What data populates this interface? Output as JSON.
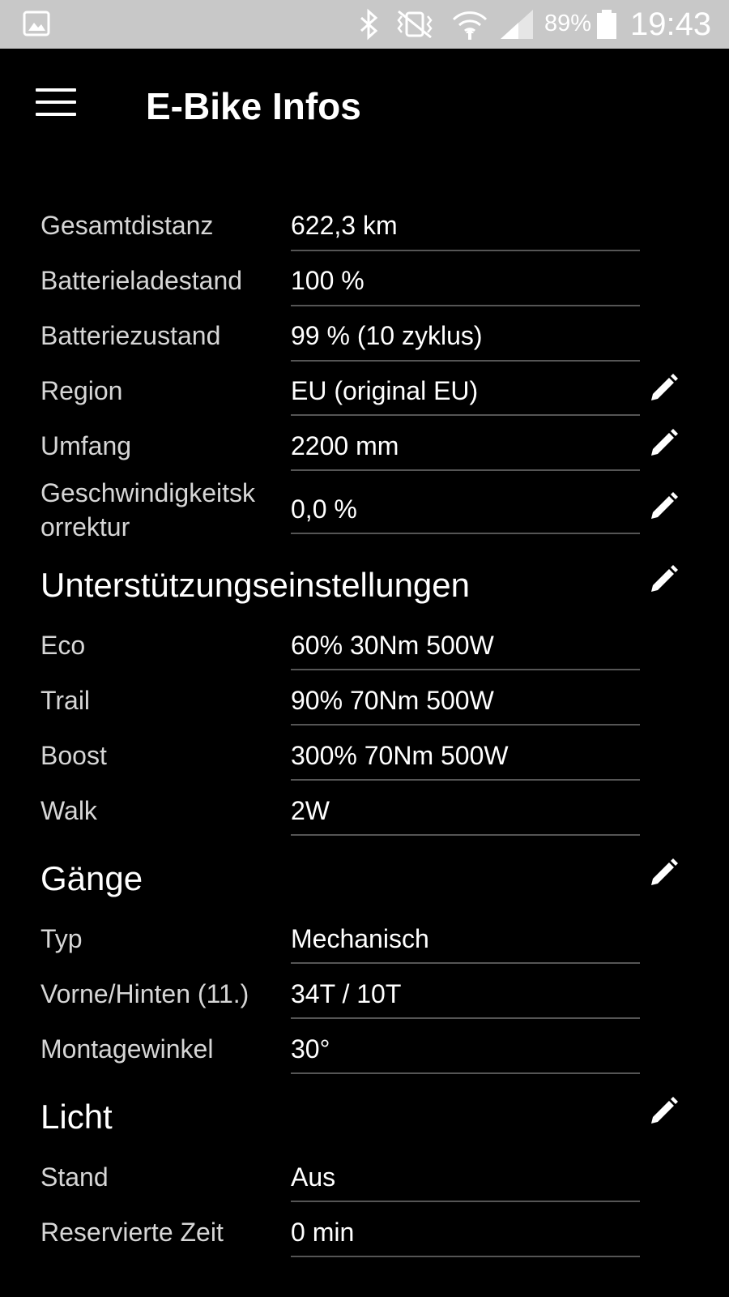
{
  "status_bar": {
    "battery_percent": "89%",
    "time": "19:43",
    "icons": [
      "gallery-icon",
      "bluetooth-icon",
      "vibrate-icon",
      "wifi-icon",
      "signal-icon",
      "battery-icon"
    ]
  },
  "app_bar": {
    "title": "E-Bike Infos",
    "menu_icon": "hamburger-menu-icon"
  },
  "general": {
    "rows": [
      {
        "label": "Gesamtdistanz",
        "value": "622,3 km"
      },
      {
        "label": "Batterieladestand",
        "value": "100 %"
      },
      {
        "label": "Batteriezustand",
        "value": "99 % (10 zyklus)"
      },
      {
        "label": "Region",
        "value": "EU (original EU)"
      },
      {
        "label": "Umfang",
        "value": "2200 mm"
      },
      {
        "label": "Geschwindigkeitskorrektur",
        "label_line1": "Geschwindigkeitsk",
        "label_line2": "orrektur",
        "value": "0,0 %"
      }
    ]
  },
  "assist": {
    "title": "Unterstützungseinstellungen",
    "rows": [
      {
        "label": "Eco",
        "value": "60% 30Nm 500W"
      },
      {
        "label": "Trail",
        "value": "90% 70Nm 500W"
      },
      {
        "label": "Boost",
        "value": "300% 70Nm 500W"
      },
      {
        "label": "Walk",
        "value": "2W"
      }
    ]
  },
  "gears": {
    "title": "Gänge",
    "rows": [
      {
        "label": "Typ",
        "value": "Mechanisch"
      },
      {
        "label": "Vorne/Hinten (11.)",
        "value": "34T / 10T"
      },
      {
        "label": "Montagewinkel",
        "value": "30°"
      }
    ]
  },
  "light": {
    "title": "Licht",
    "rows": [
      {
        "label": "Stand",
        "value": "Aus"
      },
      {
        "label": "Reservierte Zeit",
        "value": "0 min"
      }
    ]
  }
}
